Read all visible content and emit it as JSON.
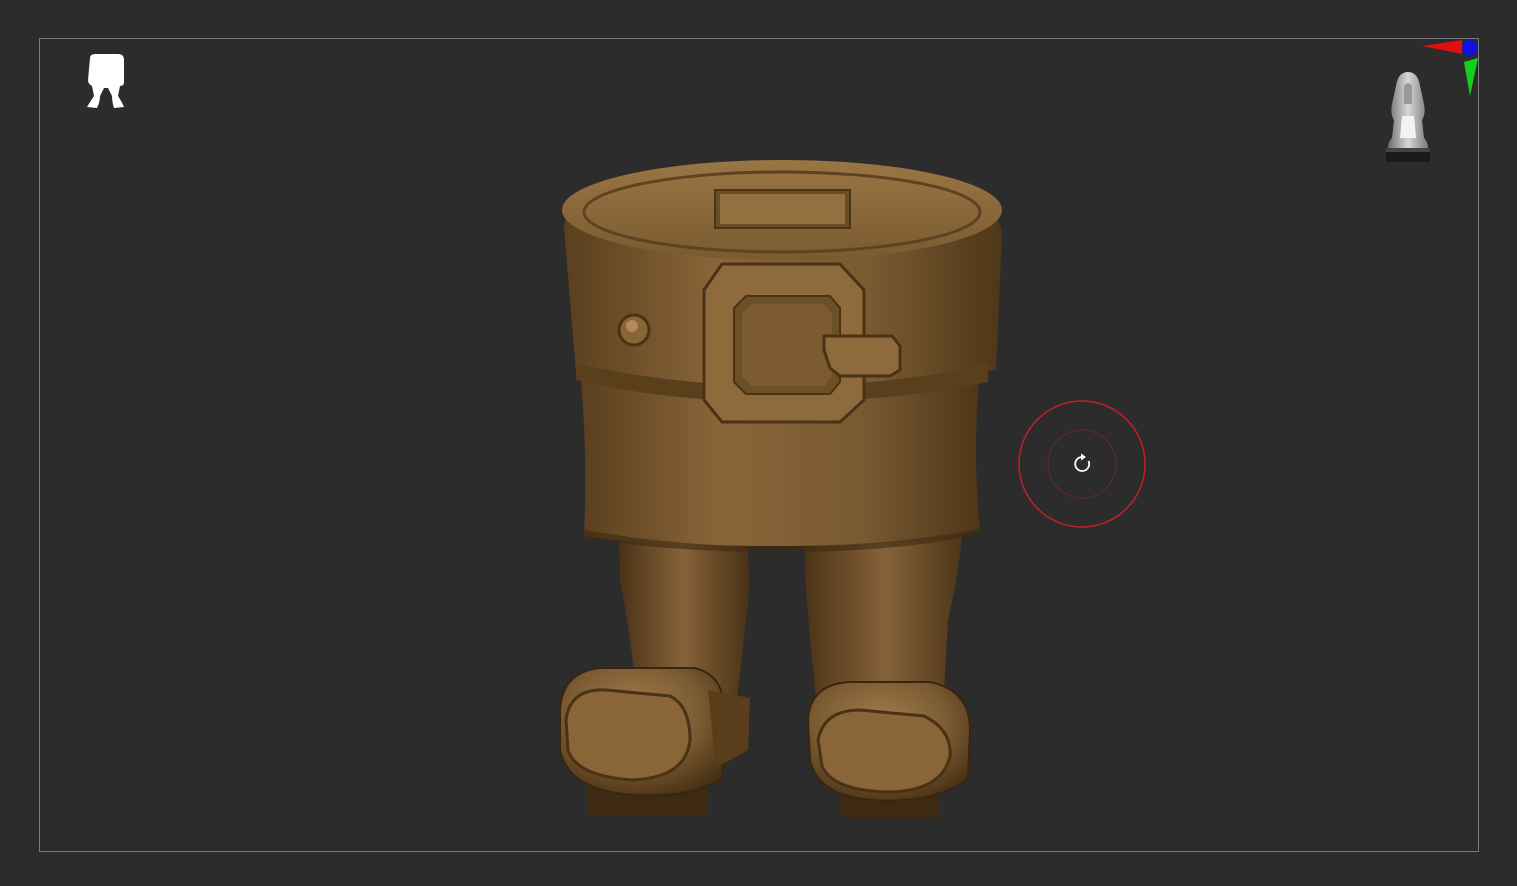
{
  "app": {
    "background_color": "#2c2c2c",
    "frame_color": "#7a7a7a"
  },
  "subtool_thumbnail": {
    "icon": "pants-silhouette-icon",
    "color": "#ffffff"
  },
  "axis_gizmo": {
    "icon": "xyz-axis-gizmo-icon",
    "x_color": "#e01010",
    "y_color": "#10d020",
    "z_color": "#1010e0"
  },
  "navigation_cube": {
    "icon": "navigation-cube-head-icon"
  },
  "model": {
    "name": "pants-boots-mesh",
    "material_color": "#7a5a32"
  },
  "brush_cursor": {
    "icon": "rotate-cursor-icon",
    "ring_color": "#c0202a"
  }
}
